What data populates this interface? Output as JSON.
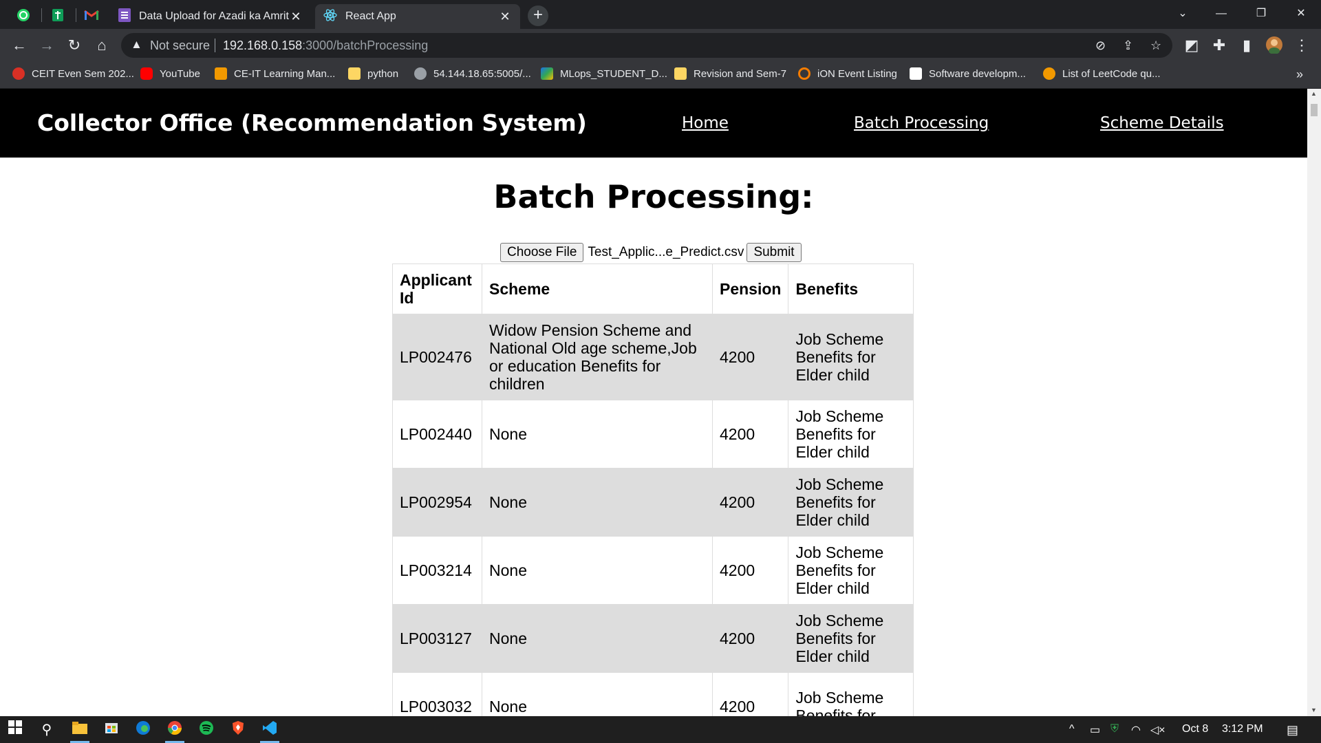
{
  "browser": {
    "tabs": [
      {
        "title": "Data Upload for Azadi ka Amrit M",
        "active": false
      },
      {
        "title": "React App",
        "active": true
      }
    ],
    "new_tab_icon": "plus-icon",
    "omnibox": {
      "security_label": "Not secure",
      "url_host": "192.168.0.158",
      "url_path": ":3000/batchProcessing"
    },
    "bookmarks": [
      {
        "label": "CEIT Even Sem 202...",
        "color": "#d93025"
      },
      {
        "label": "YouTube",
        "color": "#ff0000"
      },
      {
        "label": "CE-IT Learning Man...",
        "color": "#f29900"
      },
      {
        "label": "python",
        "color": "#fdd663"
      },
      {
        "label": "54.144.18.65:5005/...",
        "color": "#9aa0a6"
      },
      {
        "label": "MLops_STUDENT_D...",
        "color": "#1a73e8"
      },
      {
        "label": "Revision and Sem-7",
        "color": "#fdd663"
      },
      {
        "label": "iON Event Listing",
        "color": "#f57c00"
      },
      {
        "label": "Software developm...",
        "color": "#ffffff"
      },
      {
        "label": "List of LeetCode qu...",
        "color": "#f29900"
      }
    ],
    "bookmarks_overflow": "»"
  },
  "app": {
    "title": "Collector Office (Recommendation System)",
    "nav": {
      "home": "Home",
      "batch": "Batch Processing",
      "schemes": "Scheme Details"
    },
    "heading": "Batch Processing:",
    "upload": {
      "choose_label": "Choose File",
      "file_name": "Test_Applic...e_Predict.csv",
      "submit_label": "Submit"
    },
    "table": {
      "headers": {
        "id": "Applicant Id",
        "scheme": "Scheme",
        "pension": "Pension",
        "benefits": "Benefits"
      },
      "rows": [
        {
          "id": "LP002476",
          "scheme": "Widow Pension Scheme and National Old age scheme,Job or education Benefits for children",
          "pension": "4200",
          "benefits": "Job Scheme Benefits for Elder child"
        },
        {
          "id": "LP002440",
          "scheme": "None",
          "pension": "4200",
          "benefits": "Job Scheme Benefits for Elder child"
        },
        {
          "id": "LP002954",
          "scheme": "None",
          "pension": "4200",
          "benefits": "Job Scheme Benefits for Elder child"
        },
        {
          "id": "LP003214",
          "scheme": "None",
          "pension": "4200",
          "benefits": "Job Scheme Benefits for Elder child"
        },
        {
          "id": "LP003127",
          "scheme": "None",
          "pension": "4200",
          "benefits": "Job Scheme Benefits for Elder child"
        },
        {
          "id": "LP003032",
          "scheme": "None",
          "pension": "4200",
          "benefits": "Job Scheme Benefits for"
        }
      ]
    }
  },
  "taskbar": {
    "date": "Oct 8",
    "time": "3:12 PM"
  }
}
